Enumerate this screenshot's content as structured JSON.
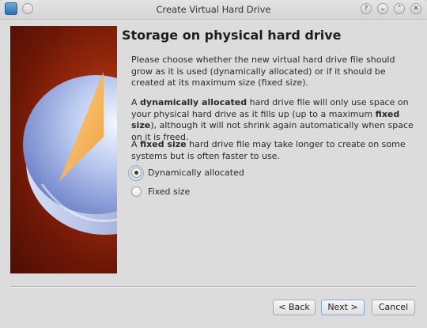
{
  "window": {
    "title": "Create Virtual Hard Drive"
  },
  "titlebar_buttons": {
    "help": "?",
    "minimize": "⌄",
    "maximize": "⌃",
    "close": "✕"
  },
  "page": {
    "heading": "Storage on physical hard drive",
    "p1": "Please choose whether the new virtual hard drive file should grow as it is used (dynamically allocated) or if it should be created at its maximum size (fixed size).",
    "p2_before": "A ",
    "p2_bold1": "dynamically allocated",
    "p2_mid": " hard drive file will only use space on your physical hard drive as it fills up (up to a maximum ",
    "p2_bold2": "fixed size",
    "p2_after": "), although it will not shrink again automatically when space on it is freed.",
    "p3_before": "A ",
    "p3_bold": "fixed size",
    "p3_after": " hard drive file may take longer to create on some systems but is often faster to use."
  },
  "options": [
    {
      "label": "Dynamically allocated",
      "selected": true
    },
    {
      "label": "Fixed size",
      "selected": false
    }
  ],
  "buttons": {
    "back": "< Back",
    "next": "Next >",
    "cancel": "Cancel"
  }
}
